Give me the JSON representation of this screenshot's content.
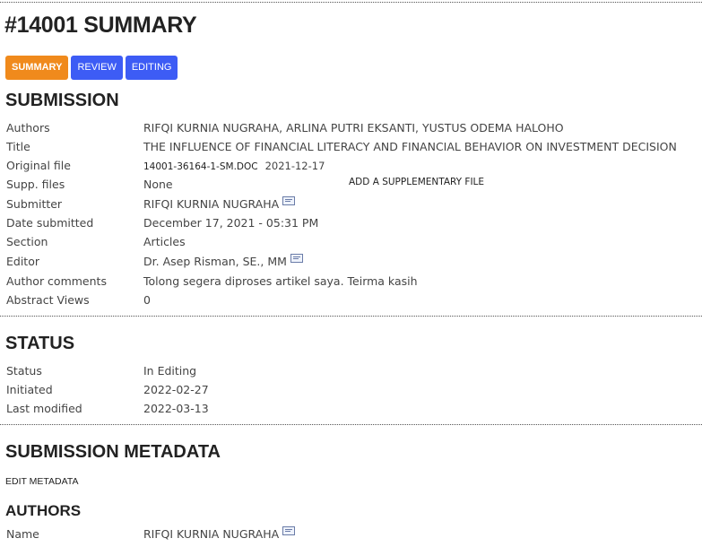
{
  "page_title": "#14001 SUMMARY",
  "tabs": [
    {
      "label": "SUMMARY",
      "active": true
    },
    {
      "label": "REVIEW",
      "active": false
    },
    {
      "label": "EDITING",
      "active": false
    }
  ],
  "submission": {
    "heading": "SUBMISSION",
    "authors_label": "Authors",
    "authors_value": "RIFQI KURNIA NUGRAHA, ARLINA PUTRI EKSANTI, YUSTUS ODEMA HALOHO",
    "title_label": "Title",
    "title_value": "THE INFLUENCE OF FINANCIAL LITERACY AND FINANCIAL BEHAVIOR ON INVESTMENT DECISION",
    "original_file_label": "Original file",
    "original_file_name": "14001-36164-1-SM.DOC",
    "original_file_date": "2021-12-17",
    "supp_files_label": "Supp. files",
    "supp_files_value": "None",
    "add_supp_link": "ADD A SUPPLEMENTARY FILE",
    "submitter_label": "Submitter",
    "submitter_value": "RIFQI KURNIA NUGRAHA",
    "date_submitted_label": "Date submitted",
    "date_submitted_value": "December 17, 2021 - 05:31 PM",
    "section_label": "Section",
    "section_value": "Articles",
    "editor_label": "Editor",
    "editor_value": "Dr. Asep Risman, SE., MM",
    "author_comments_label": "Author comments",
    "author_comments_value": "Tolong segera diproses artikel saya. Teirma kasih",
    "abstract_views_label": "Abstract Views",
    "abstract_views_value": "0"
  },
  "status": {
    "heading": "STATUS",
    "status_label": "Status",
    "status_value": "In Editing",
    "initiated_label": "Initiated",
    "initiated_value": "2022-02-27",
    "last_modified_label": "Last modified",
    "last_modified_value": "2022-03-13"
  },
  "metadata": {
    "heading": "SUBMISSION METADATA",
    "edit_link": "EDIT METADATA",
    "authors_heading": "AUTHORS",
    "name_label": "Name",
    "name_value": "RIFQI KURNIA NUGRAHA"
  },
  "icons": {
    "mail": "envelope-icon"
  },
  "colors": {
    "active_tab": "#f08a1c",
    "inactive_tab": "#3d5cf5"
  }
}
